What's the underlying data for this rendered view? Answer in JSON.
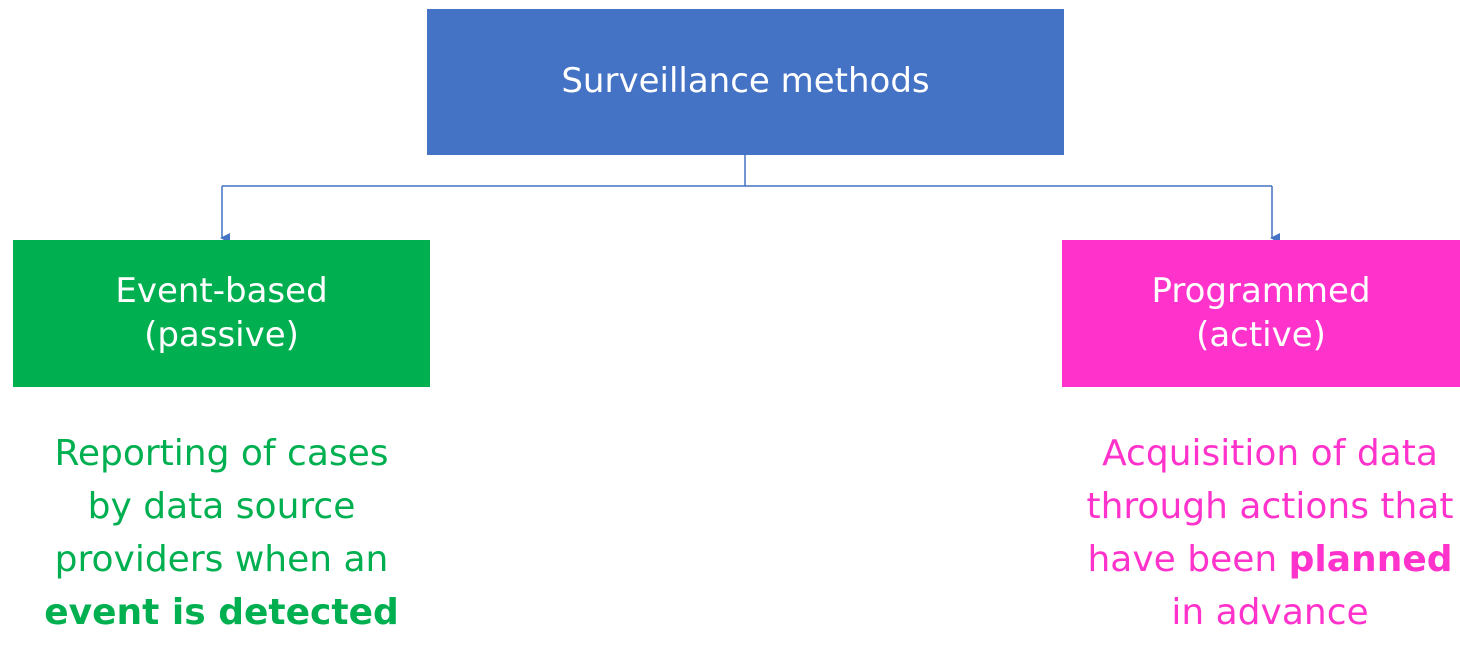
{
  "root": {
    "label": "Surveillance methods",
    "color": "#4472C4"
  },
  "branches": [
    {
      "id": "event-based",
      "title_line1": "Event-based",
      "title_line2": "(passive)",
      "color": "#00B050",
      "description": {
        "line1": "Reporting of cases",
        "line2": "by data source",
        "line3": "providers when an",
        "line4_bold": "event is detected"
      }
    },
    {
      "id": "programmed",
      "title_line1": "Programmed",
      "title_line2": "(active)",
      "color": "#FF33CC",
      "description": {
        "line1": "Acquisition of data",
        "line2": "through actions that",
        "line3_pre": "have been ",
        "line3_bold": "planned",
        "line4": "in advance"
      }
    }
  ],
  "connector_color": "#4472C4"
}
